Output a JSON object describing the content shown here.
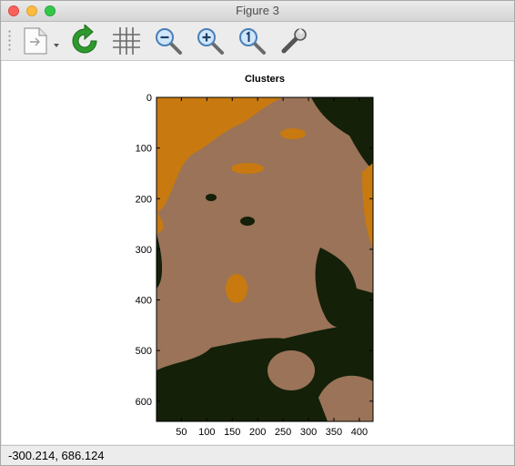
{
  "window": {
    "title": "Figure 3"
  },
  "toolbar": {
    "tools": [
      {
        "name": "save-figure",
        "icon": "document-save-icon"
      },
      {
        "name": "refresh",
        "icon": "refresh-icon"
      },
      {
        "name": "grid",
        "icon": "grid-icon"
      },
      {
        "name": "zoom-out",
        "icon": "zoom-out-icon"
      },
      {
        "name": "zoom-in",
        "icon": "zoom-in-icon"
      },
      {
        "name": "zoom-reset",
        "icon": "zoom-1-icon"
      },
      {
        "name": "properties",
        "icon": "wrench-icon"
      }
    ]
  },
  "figure": {
    "title": "Clusters",
    "xticks": [
      "50",
      "100",
      "150",
      "200",
      "250",
      "300",
      "350",
      "400"
    ],
    "yticks": [
      "0",
      "100",
      "200",
      "300",
      "400",
      "500",
      "600"
    ],
    "colors": {
      "cluster_1": "#c87a10",
      "cluster_2": "#9a7358",
      "cluster_3": "#142008"
    }
  },
  "statusbar": {
    "coords": "-300.214,  686.124"
  }
}
